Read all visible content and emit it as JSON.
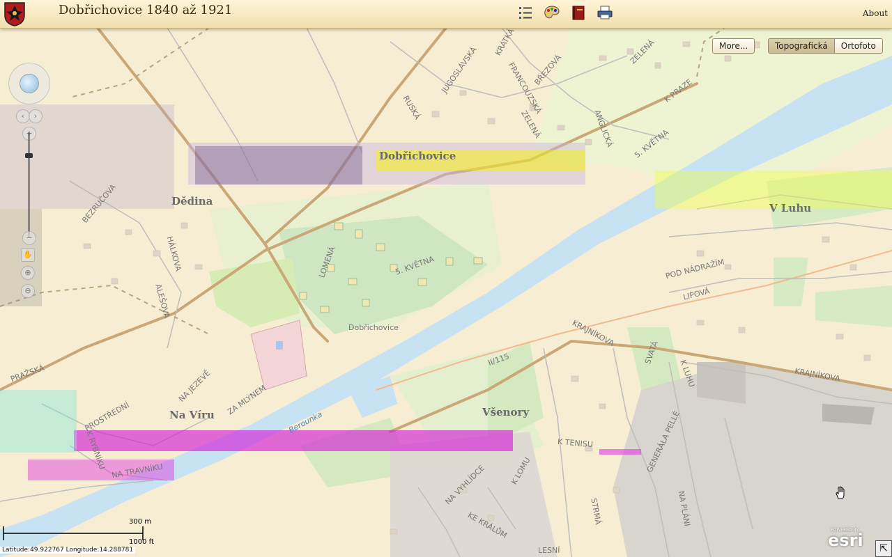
{
  "header": {
    "title": "Dobřichovice 1840 až 1921",
    "about_label": "About",
    "tools": [
      {
        "name": "legend-list-icon"
      },
      {
        "name": "palette-icon"
      },
      {
        "name": "book-icon"
      },
      {
        "name": "printer-icon"
      }
    ]
  },
  "basemap": {
    "more_label": "More...",
    "options": [
      "Topografická",
      "Ortofoto"
    ],
    "selected": "Topografická"
  },
  "map": {
    "place_labels": [
      "Dobřichovice",
      "Dědina",
      "V Luhu",
      "Na Víru",
      "Všenory",
      "Dobřichovice"
    ],
    "street_labels": [
      "KRÁTKÁ",
      "JUGOSLÁVSKÁ",
      "FRANCOUZSKÁ",
      "BŘEZOVÁ",
      "ZELENÁ",
      "RUSKÁ",
      "ZELENÁ",
      "ANGLICKÁ",
      "5. KVĚTNA",
      "K PRAZE",
      "BEZRUČOVA",
      "HÁLKOVA",
      "ALEŠOVA",
      "LOMENÁ",
      "5. KVĚTNA",
      "PRAŽSKÁ",
      "NA JEZEVĚ",
      "PROSTŘEDNÍ",
      "ZA MLÝNEM",
      "NA TRAVNÍKU",
      "K RYBNÍKU",
      "Berounka",
      "POD NÁDRAŽÍM",
      "LIPOVÁ",
      "KRAJNÍKOVA",
      "KRAJNÍKOVA",
      "SVATÁ",
      "K LUHU",
      "GENERÁLA PELLÉ",
      "K TENISU",
      "K LOMU",
      "NA VYHLÍDCE",
      "KE KRÁLŮM",
      "STRMÁ",
      "LESNÍ",
      "NA PLÁNI",
      "II/115"
    ]
  },
  "scale": {
    "metric": "300 m",
    "imperial": "1000 ft"
  },
  "coords": {
    "text": "Latitude:49.922767   Longitude:14.288781"
  },
  "attribution": {
    "powered": "POWERED BY",
    "brand": "esri"
  },
  "colors": {
    "header_bg": "#f1dfae",
    "river": "#c7e2f3",
    "green": "#d8ecc8",
    "road": "#d9b98a"
  }
}
